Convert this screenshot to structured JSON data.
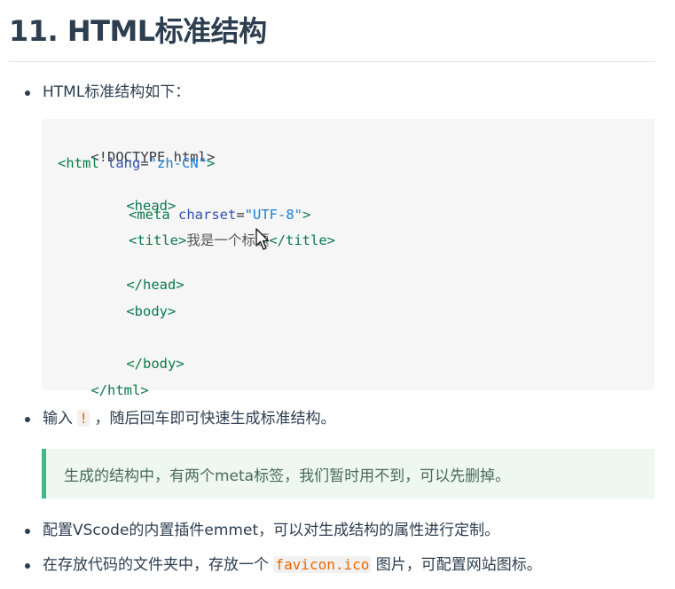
{
  "heading": "11. HTML标准结构",
  "bullets": [
    {
      "text": "HTML标准结构如下："
    },
    {
      "text_before": "输入",
      "code": "!",
      "text_after": "，随后回车即可快速生成标准结构。"
    },
    {
      "text": "配置VScode的内置插件emmet，可以对生成结构的属性进行定制。"
    },
    {
      "text_before": "在存放代码的文件夹中，存放一个",
      "code": "favicon.ico",
      "text_after": "图片，可配置网站图标。"
    }
  ],
  "code": {
    "doctype": "<!DOCTYPE html>",
    "html_open_tag": "<html",
    "html_attr": "lang",
    "html_attr_val": "\"zh-CN\"",
    "head_open": "<head>",
    "meta_open": "<meta",
    "meta_attr": "charset",
    "meta_attr_val": "\"UTF-8\"",
    "title_open": "<title>",
    "title_text": "我是一个标题",
    "title_close": "</title>",
    "head_close": "</head>",
    "body_open": "<body>",
    "body_close": "</body>",
    "html_close": "</html>"
  },
  "tip": "生成的结构中，有两个meta标签，我们暂时用不到，可以先删掉。",
  "colors": {
    "tip_border": "#42b983",
    "tag": "#0b7a4f",
    "attr": "#3451b2",
    "string": "#1a7fd6"
  }
}
